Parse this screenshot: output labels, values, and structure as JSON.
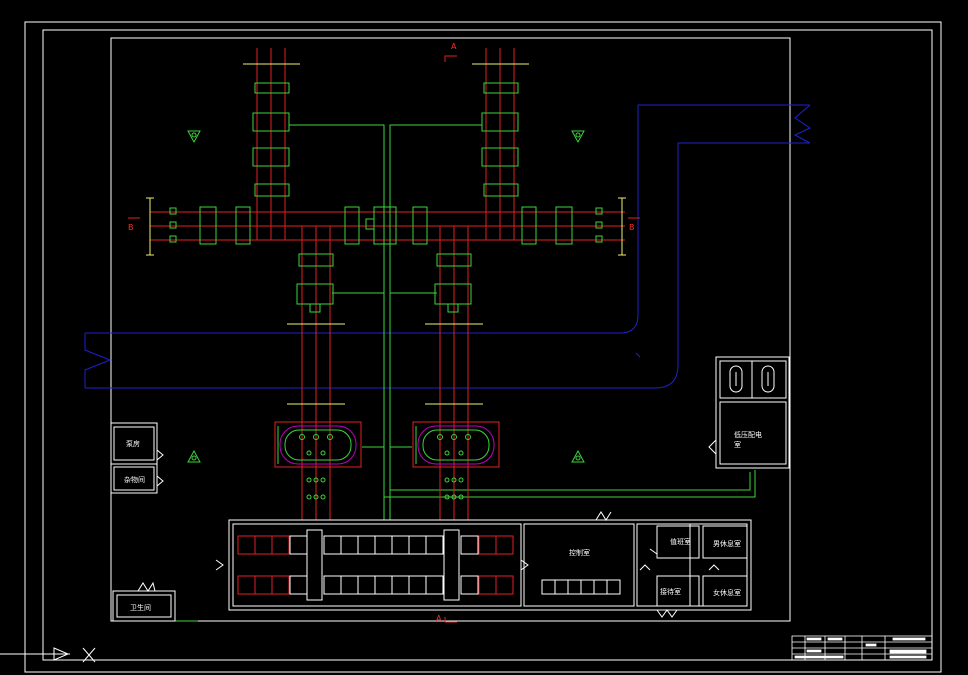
{
  "colors": {
    "background": "#000000",
    "frame": "#ffffff",
    "busbar": "#e02020",
    "control_line": "#3cd43c",
    "cable_trench": "#2020d0",
    "equipment": "#3cd43c",
    "dimension": "#f0f070",
    "transformer_outline": "#c000c0"
  },
  "section_marks": {
    "a_top": "A",
    "a_bottom": "A",
    "b_left": "B",
    "b_right": "B"
  },
  "rooms": {
    "pump_room": "泵房",
    "storage": "杂物间",
    "guard_room": "卫生间",
    "low_voltage_room_line1": "低压配电",
    "low_voltage_room_line2": "室",
    "control_room": "控制室",
    "duty_room": "值班室",
    "male_rest_room": "男休息室",
    "reception_room": "接待室",
    "female_rest_room": "女休息室"
  },
  "icons": {
    "lightning_rod": "lightning-rod-triangle-icon",
    "transformer": "transformer-icon",
    "switch": "disconnect-switch-icon",
    "door": "door-swing-icon",
    "ucs": "ucs-axis-icon"
  }
}
